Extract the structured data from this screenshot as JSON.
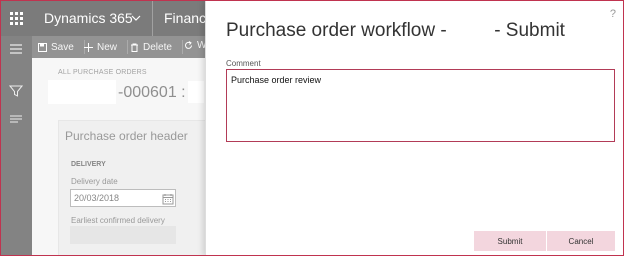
{
  "app": {
    "brand": "Dynamics 365",
    "module": "Finance",
    "actions": [
      "Save",
      "New",
      "Delete",
      "W"
    ],
    "breadcrumb": "ALL PURCHASE ORDERS",
    "record_title": "-000601 :",
    "card": {
      "title": "Purchase order header",
      "section": "DELIVERY",
      "delivery_date_label": "Delivery date",
      "delivery_date_value": "20/03/2018",
      "earliest_label": "Earliest confirmed delivery"
    }
  },
  "dialog": {
    "title": "Purchase order workflow -         - Submit",
    "help": "?",
    "comment_label": "Comment",
    "comment_value": "Purchase order review",
    "submit_label": "Submit",
    "cancel_label": "Cancel"
  },
  "colors": {
    "accent": "#b23b57",
    "button_bg": "#f3d6de",
    "topbar": "#0f0f0f"
  }
}
